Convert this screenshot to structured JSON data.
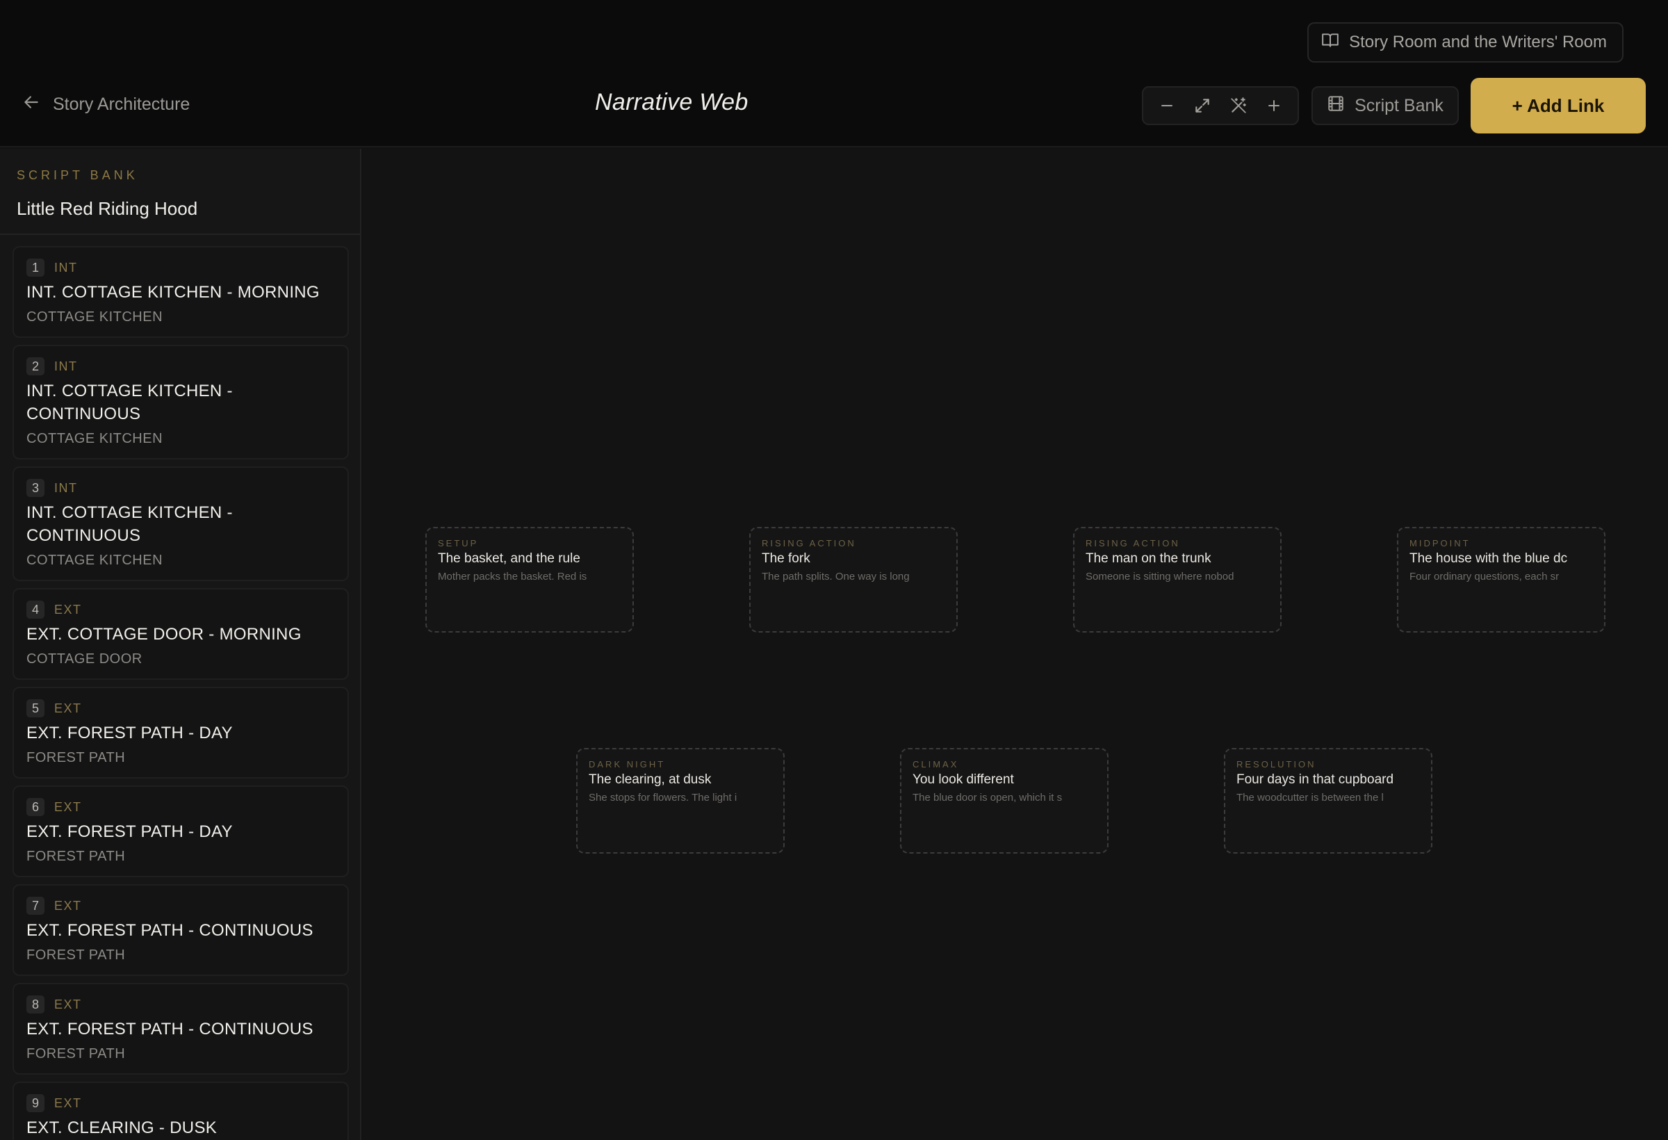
{
  "header": {
    "room_link": "Story Room and the Writers' Room",
    "back_label": "Story Architecture",
    "title": "Narrative Web",
    "script_bank_label": "Script Bank",
    "add_link_label": "+ Add Link"
  },
  "sidebar": {
    "kicker": "SCRIPT BANK",
    "title": "Little Red Riding Hood",
    "scenes": [
      {
        "num": "1",
        "type": "INT",
        "heading": "INT. COTTAGE KITCHEN - MORNING",
        "location": "COTTAGE KITCHEN"
      },
      {
        "num": "2",
        "type": "INT",
        "heading": "INT. COTTAGE KITCHEN - CONTINUOUS",
        "location": "COTTAGE KITCHEN"
      },
      {
        "num": "3",
        "type": "INT",
        "heading": "INT. COTTAGE KITCHEN - CONTINUOUS",
        "location": "COTTAGE KITCHEN"
      },
      {
        "num": "4",
        "type": "EXT",
        "heading": "EXT. COTTAGE DOOR - MORNING",
        "location": "COTTAGE DOOR"
      },
      {
        "num": "5",
        "type": "EXT",
        "heading": "EXT. FOREST PATH - DAY",
        "location": "FOREST PATH"
      },
      {
        "num": "6",
        "type": "EXT",
        "heading": "EXT. FOREST PATH - DAY",
        "location": "FOREST PATH"
      },
      {
        "num": "7",
        "type": "EXT",
        "heading": "EXT. FOREST PATH - CONTINUOUS",
        "location": "FOREST PATH"
      },
      {
        "num": "8",
        "type": "EXT",
        "heading": "EXT. FOREST PATH - CONTINUOUS",
        "location": "FOREST PATH"
      },
      {
        "num": "9",
        "type": "EXT",
        "heading": "EXT. CLEARING - DUSK",
        "location": ""
      }
    ]
  },
  "canvas": {
    "nodes": [
      {
        "kicker": "SETUP",
        "title": "The basket, and the rule",
        "text": "Mother packs the basket. Red is"
      },
      {
        "kicker": "RISING ACTION",
        "title": "The fork",
        "text": "The path splits. One way is long"
      },
      {
        "kicker": "RISING ACTION",
        "title": "The man on the trunk",
        "text": "Someone is sitting where nobod"
      },
      {
        "kicker": "MIDPOINT",
        "title": "The house with the blue dc",
        "text": "Four ordinary questions, each sr"
      },
      {
        "kicker": "DARK NIGHT",
        "title": "The clearing, at dusk",
        "text": "She stops for flowers. The light i"
      },
      {
        "kicker": "CLIMAX",
        "title": "You look different",
        "text": "The blue door is open, which it s"
      },
      {
        "kicker": "RESOLUTION",
        "title": "Four days in that cupboard",
        "text": "The woodcutter is between the l"
      }
    ]
  },
  "icons": {
    "room_link": "book-open-icon",
    "back": "arrow-left-icon",
    "zoom_out": "minus-icon",
    "fit": "expand-icon",
    "auto_layout": "magic-wand-icon",
    "zoom_in": "plus-icon",
    "script_bank": "film-icon"
  },
  "colors": {
    "accent": "#d2ad4d",
    "background": "#121212",
    "kicker": "#8f7a45"
  }
}
